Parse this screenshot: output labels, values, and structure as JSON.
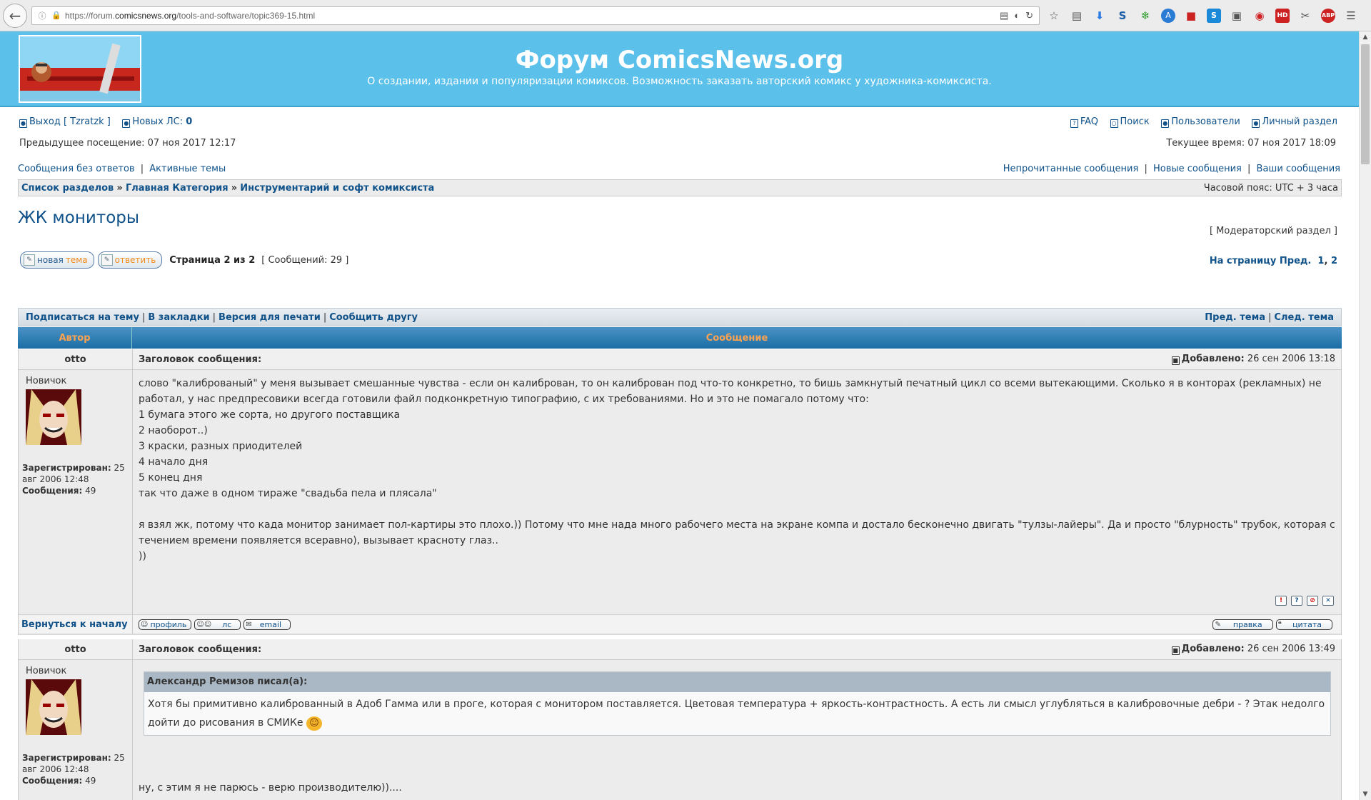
{
  "browser": {
    "url_prefix": "https://forum.",
    "url_domain": "comicsnews.org",
    "url_path": "/tools-and-software/topic369-15.html"
  },
  "header": {
    "title": "Форум ComicsNews.org",
    "description": "О создании, издании и популяризации комиксов. Возможность заказать авторский комикс у художника-комиксиста."
  },
  "user_bar": {
    "logout_label": "Выход [ Tzratzk ]",
    "new_pm_label": "Новых ЛС:",
    "new_pm_count": "0",
    "faq": "FAQ",
    "search": "Поиск",
    "users": "Пользователи",
    "ucp": "Личный раздел",
    "last_visit": "Предыдущее посещение: 07 ноя 2017 12:17",
    "current_time": "Текущее время: 07 ноя 2017 18:09"
  },
  "quick_links": {
    "unanswered": "Сообщения без ответов",
    "active": "Активные темы",
    "unread": "Непрочитанные сообщения",
    "new_posts": "Новые сообщения",
    "your_posts": "Ваши сообщения",
    "sep": "|"
  },
  "breadcrumb": {
    "items": [
      "Список разделов",
      "Главная Категория",
      "Инструментарий и софт комиксиста"
    ],
    "sep": "»",
    "timezone": "Часовой пояс: UTC + 3 часа"
  },
  "topic": {
    "title": "ЖК мониторы",
    "mod_link": "[ Модераторский раздел ]",
    "new_topic_a": "новая",
    "new_topic_b": "тема",
    "reply": "ответить",
    "page_info": "Страница 2 из 2",
    "post_count": "[ Сообщений: 29 ]",
    "pagination": "На страницу Пред.",
    "page1": "1",
    "page2": "2",
    "sep": ","
  },
  "sub_bar": {
    "subscribe": "Подписаться на тему",
    "bookmark": "В закладки",
    "print": "Версия для печати",
    "email": "Сообщить другу",
    "prev": "Пред. тема",
    "next": "След. тема",
    "sep": "|"
  },
  "table": {
    "author_header": "Автор",
    "message_header": "Сообщение",
    "subject_label": "Заголовок сообщения:",
    "added_label": "Добавлено:",
    "back_to_top": "Вернуться к началу",
    "btn_profile": "профиль",
    "btn_pm": "лс",
    "btn_email": "email",
    "btn_edit": "правка",
    "btn_quote": "цитата"
  },
  "posts": [
    {
      "author": "otto",
      "rank": "Новичок",
      "reg_label": "Зарегистрирован:",
      "reg_value": "25 авг 2006 12:48",
      "posts_label": "Сообщения:",
      "posts_value": "49",
      "date": "26 сен 2006 13:18",
      "lines": [
        "слово \"калиброваный\" у меня вызывает смешанные чувства - если он калиброван, то он калиброван под что-то конкретно, то бишь замкнутый печатный цикл со всеми вытекающими. Сколько я в конторах (рекламных) не работал, у нас предпресовики всегда готовили файл подконкретную типографию, с их требованиями. Но и это не помагало потому что:",
        "1 бумага этого же сорта, но другого поставщика",
        "2 наоборот..)",
        "3 краски, разных приодителей",
        "4 начало дня",
        "5 конец дня",
        "так что даже в одном тираже \"свадьба пела и плясала\"",
        "",
        "я взял жк, потому что када монитор занимает пол-картиры это плохо.)) Потому что мне нада много рабочего места на экране компа и достало бесконечно двигать \"тулзы-лайеры\". Да и просто \"блурность\" трубок, которая с течением времени появляется всеравно), вызывает красноту глаз..",
        "))"
      ]
    },
    {
      "author": "otto",
      "rank": "Новичок",
      "reg_label": "Зарегистрирован:",
      "reg_value": "25 авг 2006 12:48",
      "posts_label": "Сообщения:",
      "posts_value": "49",
      "date": "26 сен 2006 13:49",
      "quote_author": "Александр Ремизов писал(а):",
      "quote_text": "Хотя бы примитивно калиброванный в Адоб Гамма или в проге, которая с монитором поставляется. Цветовая температура + яркость-контрастность. А есть ли смысл углубляться в калибровочные дебри - ? Этак недолго дойти до рисования в СМИКе",
      "after_quote": "ну, с этим я не парюсь - верю производителю))...."
    }
  ],
  "colors": {
    "header_bg": "#5bc0ea",
    "link": "#105289",
    "table_head_text": "#ffa34f"
  }
}
